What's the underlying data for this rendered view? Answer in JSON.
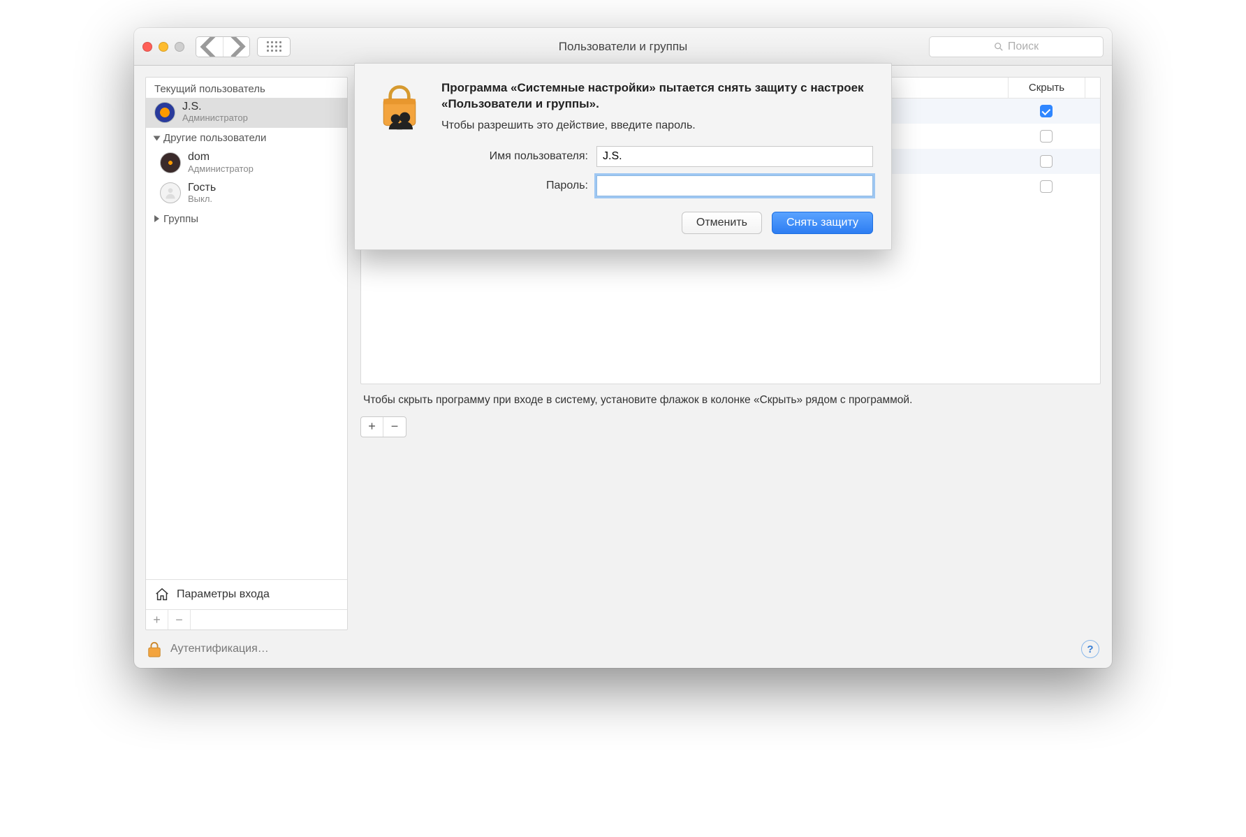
{
  "window": {
    "title": "Пользователи и группы",
    "search_placeholder": "Поиск"
  },
  "sidebar": {
    "current_label": "Текущий пользователь",
    "other_label": "Другие пользователи",
    "groups_label": "Группы",
    "login_options": "Параметры входа",
    "users": [
      {
        "name": "J.S.",
        "role": "Администратор"
      },
      {
        "name": "dom",
        "role": "Администратор"
      },
      {
        "name": "Гость",
        "role": "Выкл."
      }
    ]
  },
  "table": {
    "hide_header": "Скрыть",
    "rows": [
      {
        "checked": true
      },
      {
        "checked": false
      },
      {
        "checked": false
      },
      {
        "checked": false
      }
    ]
  },
  "hint": "Чтобы скрыть программу при входе в систему, установите флажок в колонке «Скрыть» рядом с программой.",
  "footer": {
    "auth": "Аутентификация…"
  },
  "dialog": {
    "title": "Программа «Системные настройки» пытается снять защиту с настроек «Пользователи и группы».",
    "subtitle": "Чтобы разрешить это действие, введите пароль.",
    "username_label": "Имя пользователя:",
    "password_label": "Пароль:",
    "username_value": "J.S.",
    "password_value": "",
    "cancel": "Отменить",
    "confirm": "Снять защиту"
  }
}
